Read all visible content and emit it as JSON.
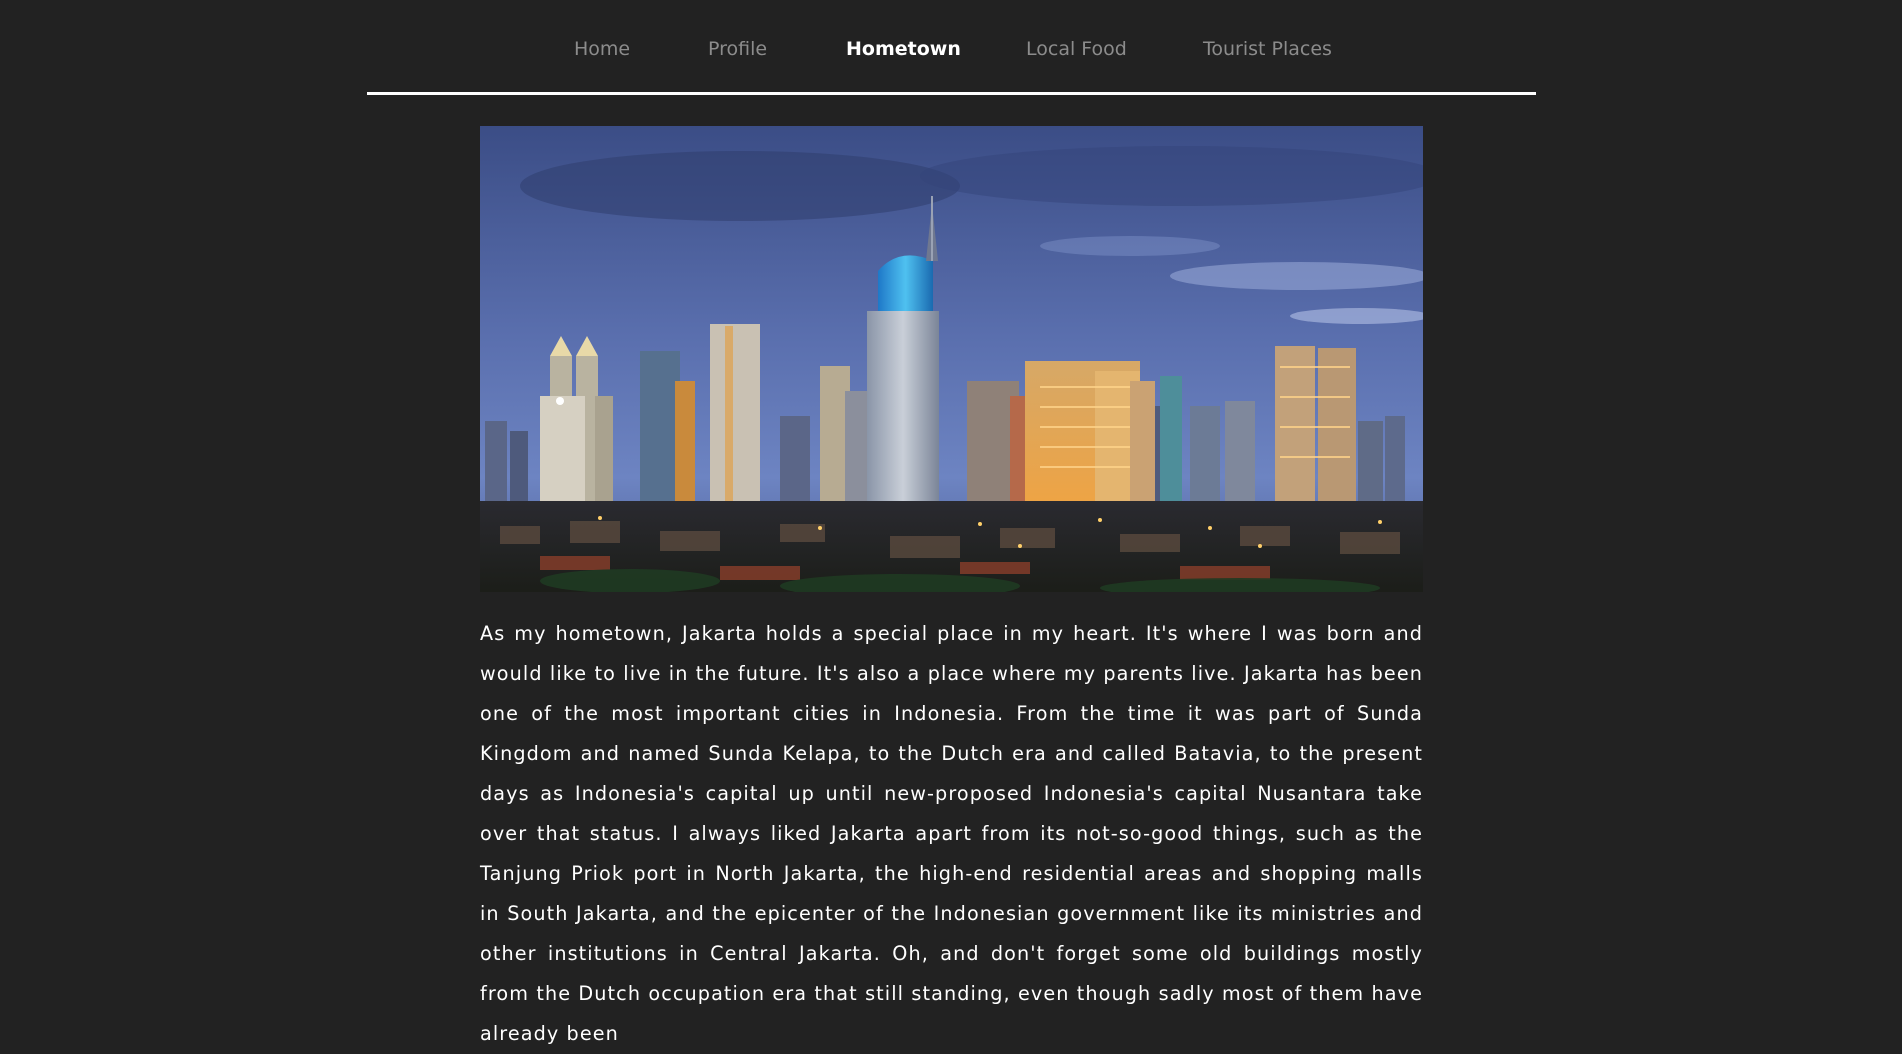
{
  "nav": {
    "items": [
      {
        "label": "Home",
        "active": false
      },
      {
        "label": "Profile",
        "active": false
      },
      {
        "label": "Hometown",
        "active": true
      },
      {
        "label": "Local Food",
        "active": false
      },
      {
        "label": "Tourist Places",
        "active": false
      }
    ]
  },
  "hero": {
    "subject": "jakarta-city-skyline-at-dusk"
  },
  "article": {
    "text": "As my hometown, Jakarta holds a special place in my heart. It's where I was born and would like to live in the future. It's also a place where my parents live. Jakarta has been one of the most important cities in Indonesia. From the time it was part of Sunda Kingdom and named Sunda Kelapa, to the Dutch era and called Batavia, to the present days as Indonesia's capital up until new-proposed Indonesia's capital Nusantara take over that status. I always liked Jakarta apart from its not-so-good things, such as the Tanjung Priok port in North Jakarta, the high-end residential areas and shopping malls in South Jakarta, and the epicenter of the Indonesian government like its ministries and other institutions in Central Jakarta. Oh, and don't forget some old buildings mostly from the Dutch occupation era that still standing, even though sadly most of them have already been"
  },
  "colors": {
    "background": "#222222",
    "nav_inactive": "#8c8c8c",
    "nav_active": "#ffffff",
    "text": "#ffffff"
  }
}
